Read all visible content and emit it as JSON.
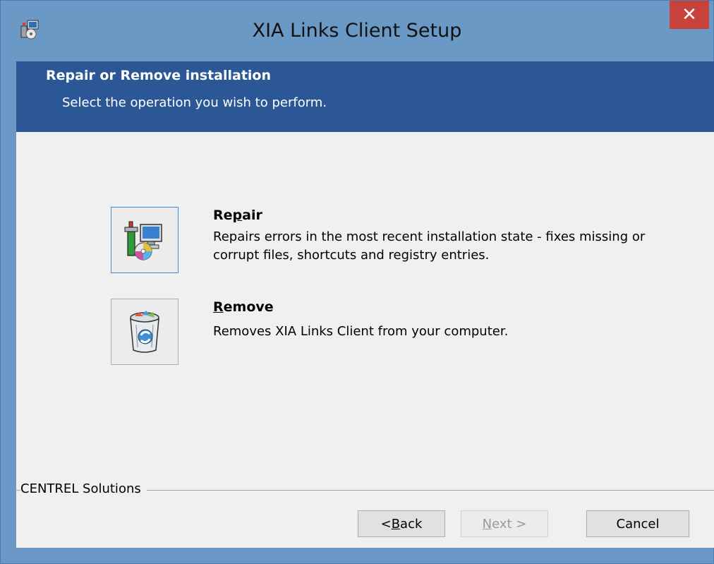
{
  "window": {
    "title": "XIA Links Client Setup",
    "close_label": "✕"
  },
  "header": {
    "title": "Repair or Remove installation",
    "subtitle": "Select the operation you wish to perform."
  },
  "options": {
    "repair": {
      "title_pre": "Re",
      "title_ul": "p",
      "title_post": "air",
      "description": "Repairs errors in the most recent installation state - fixes missing or corrupt files, shortcuts and registry entries."
    },
    "remove": {
      "title_pre": "",
      "title_ul": "R",
      "title_post": "emove",
      "description": "Removes XIA Links Client from your computer."
    }
  },
  "footer": {
    "brand": "CENTREL Solutions",
    "back": {
      "pre": "< ",
      "ul": "B",
      "post": "ack"
    },
    "next": {
      "pre": "",
      "ul": "N",
      "post": "ext >"
    },
    "cancel": "Cancel"
  }
}
